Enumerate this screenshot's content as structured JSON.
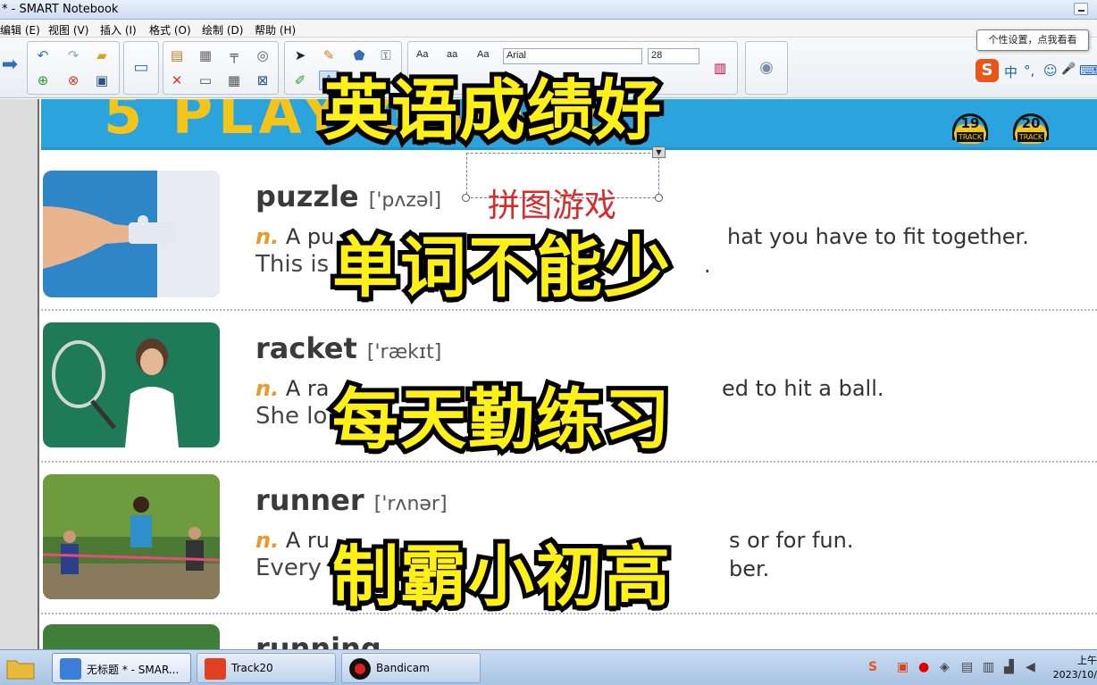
{
  "window": {
    "title": "* - SMART Notebook"
  },
  "menu": [
    "编辑 (E)",
    "视图 (V)",
    "插入 (I)",
    "格式 (O)",
    "绘制 (D)",
    "帮助 (H)"
  ],
  "toolbar": {
    "font_name": "Arial",
    "font_size": "28",
    "font_style_labels": [
      "Aa",
      "aa",
      "Aa"
    ]
  },
  "tooltip": "个性设置，点我看看",
  "ime": {
    "logo": "S",
    "mode": "中",
    "punct": "°,",
    "emoji": "☺",
    "mic": "🎤",
    "keyboard": "⌨"
  },
  "lesson": {
    "banner_text": "5 PLAY GAMES",
    "tracks": [
      {
        "num": "19",
        "label": "TRACK"
      },
      {
        "num": "20",
        "label": "TRACK"
      }
    ],
    "selection_text": "拼图游戏",
    "entries": [
      {
        "word": "puzzle",
        "ipa": "['pʌzəl]",
        "def_pos": "n.",
        "def_start": "A pu",
        "def_end": "hat you have to fit together.",
        "ex_start": "This is",
        "ex_end": "."
      },
      {
        "word": "racket",
        "ipa": "['rækɪt]",
        "def_pos": "n.",
        "def_start": "A ra",
        "def_end": "ed to hit a ball.",
        "ex_start": "She lo",
        "ex_end": ""
      },
      {
        "word": "runner",
        "ipa": "['rʌnər]",
        "def_pos": "n.",
        "def_start": "A ru",
        "def_end": "s or for fun.",
        "ex_start": "Every",
        "ex_end": "ber."
      },
      {
        "word": "running",
        "ipa": ""
      }
    ]
  },
  "captions": [
    "英语成绩好",
    "单词不能少",
    "每天勤练习",
    "制霸小初高"
  ],
  "taskbar": {
    "tasks": [
      {
        "label": "无标题 * - SMAR...",
        "icon_color": "#3b7dd8"
      },
      {
        "label": "Track20",
        "icon_color": "#e0401f"
      },
      {
        "label": "Bandicam",
        "icon_color": "#111111"
      }
    ],
    "clock_line1": "上午",
    "clock_line2": "2023/10/"
  },
  "colors": {
    "banner": "#2ba3dd",
    "caption_fill": "#fff018",
    "selection_text": "#d62c2c",
    "pos_label": "#e89a2a"
  }
}
